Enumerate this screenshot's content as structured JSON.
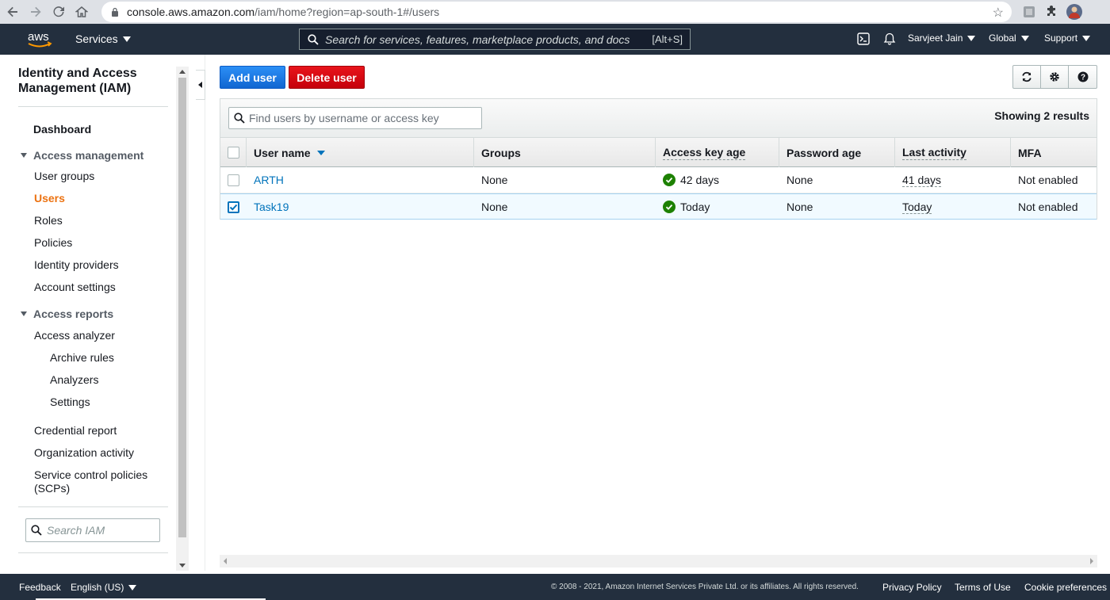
{
  "browser": {
    "url_host": "console.aws.amazon.com",
    "url_path": "/iam/home?region=ap-south-1#/users"
  },
  "topnav": {
    "services_label": "Services",
    "search_placeholder": "Search for services, features, marketplace products, and docs",
    "search_shortcut": "[Alt+S]",
    "user_label": "Sarvjeet Jain",
    "region_label": "Global",
    "support_label": "Support",
    "bg_color": "#232f3e",
    "logo_text": "aws"
  },
  "sidebar": {
    "title": "Identity and Access Management (IAM)",
    "dashboard": "Dashboard",
    "access_management": {
      "label": "Access management",
      "items": [
        "User groups",
        "Users",
        "Roles",
        "Policies",
        "Identity providers",
        "Account settings"
      ],
      "active": "Users"
    },
    "access_reports": {
      "label": "Access reports",
      "analyzer": "Access analyzer",
      "analyzer_sub": [
        "Archive rules",
        "Analyzers",
        "Settings"
      ],
      "items": [
        "Credential report",
        "Organization activity",
        "Service control policies (SCPs)"
      ]
    },
    "search_placeholder": "Search IAM"
  },
  "toolbar": {
    "add_user_label": "Add user",
    "delete_user_label": "Delete user",
    "tools": [
      "refresh-icon",
      "gear-icon",
      "help-icon"
    ]
  },
  "table": {
    "filter_placeholder": "Find users by username or access key",
    "showing": "Showing 2 results",
    "columns": [
      "User name",
      "Groups",
      "Access key age",
      "Password age",
      "Last activity",
      "MFA"
    ],
    "rows": [
      {
        "user": "ARTH",
        "groups": "None",
        "key_age": "42 days",
        "password_age": "None",
        "last_activity": "41 days",
        "mfa": "Not enabled",
        "selected": false
      },
      {
        "user": "Task19",
        "groups": "None",
        "key_age": "Today",
        "password_age": "None",
        "last_activity": "Today",
        "mfa": "Not enabled",
        "selected": true
      }
    ]
  },
  "footer": {
    "feedback": "Feedback",
    "language": "English (US)",
    "copyright": "© 2008 - 2021, Amazon Internet Services Private Ltd. or its affiliates. All rights reserved.",
    "privacy": "Privacy Policy",
    "terms": "Terms of Use",
    "cookies": "Cookie preferences"
  },
  "colors": {
    "accent_blue": "#0073bb",
    "active_orange": "#ec7211",
    "delete_red": "#d13212",
    "success_green": "#1d8102"
  }
}
